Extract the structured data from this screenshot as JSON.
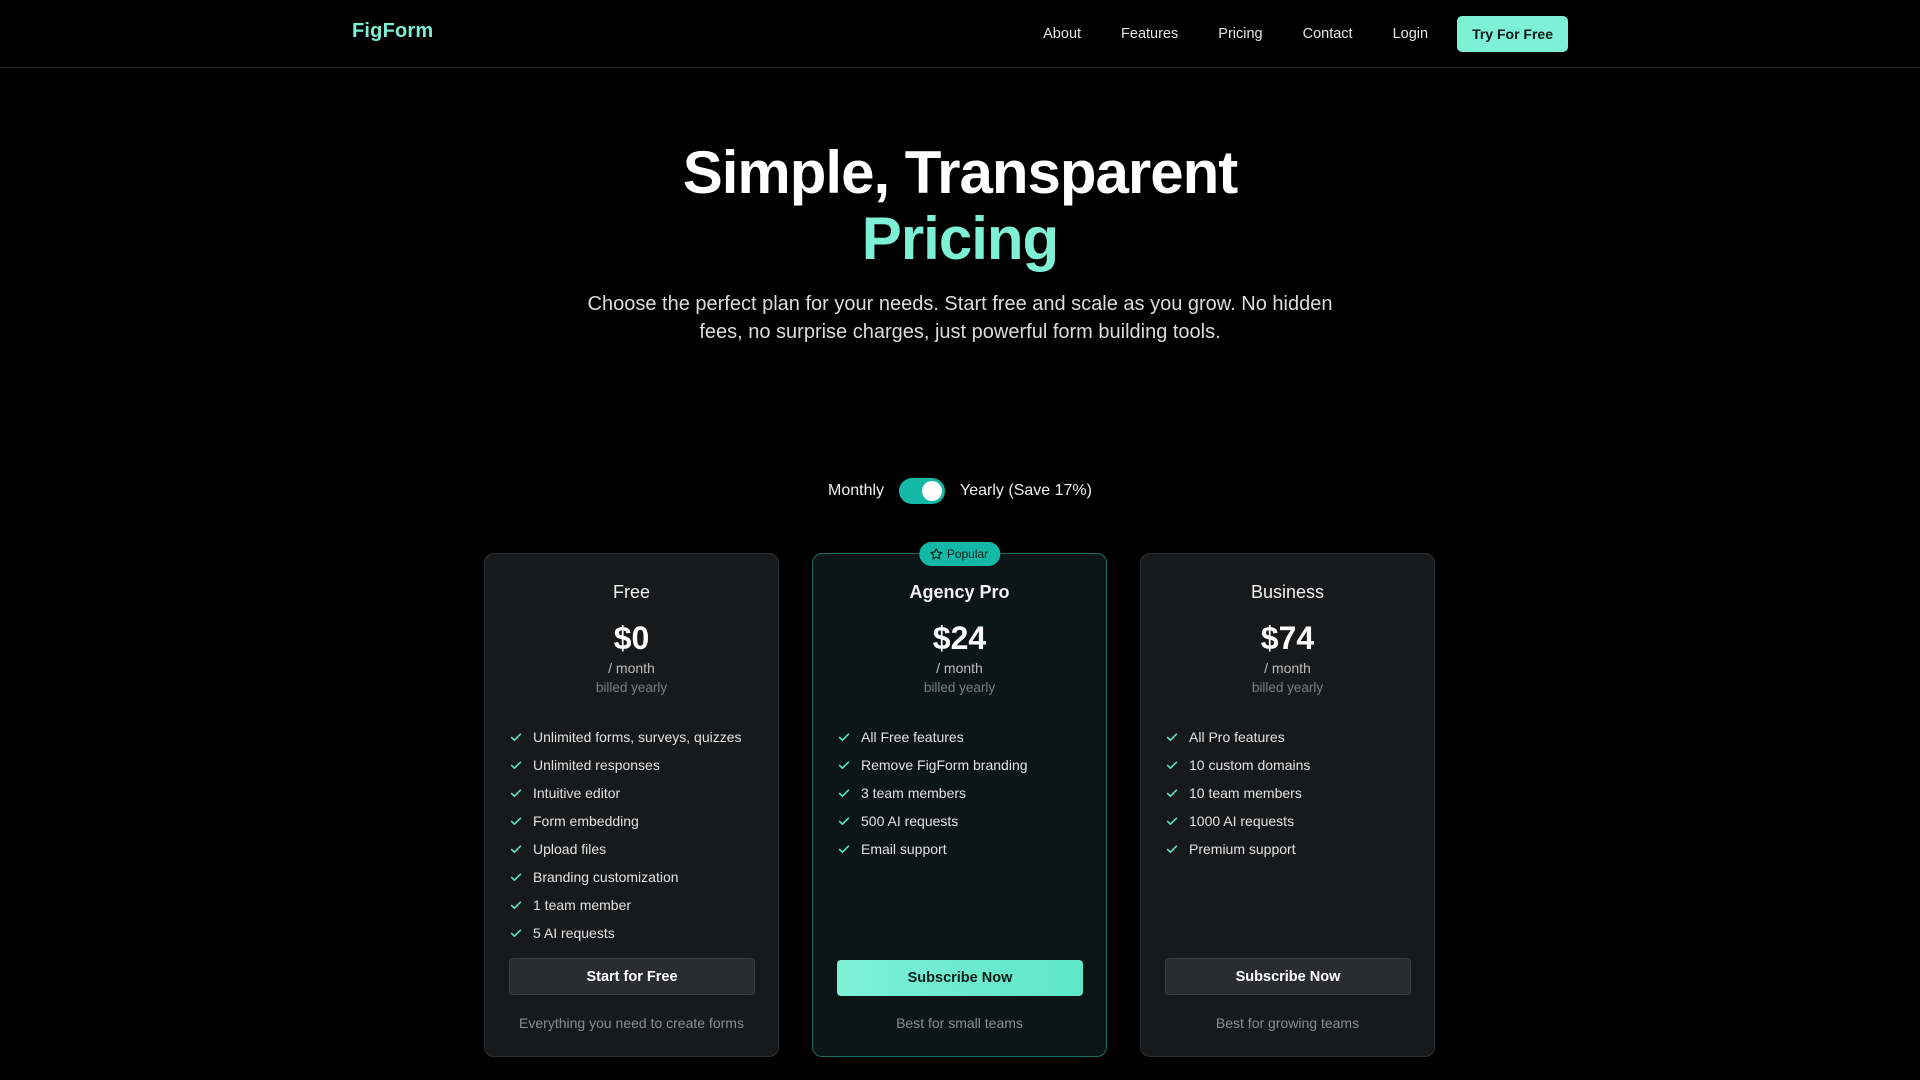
{
  "nav": {
    "logo": "FigForm",
    "links": [
      "About",
      "Features",
      "Pricing",
      "Contact",
      "Login"
    ],
    "cta": "Try For Free"
  },
  "hero": {
    "title_line1": "Simple, Transparent",
    "title_line2": "Pricing",
    "subtitle": "Choose the perfect plan for your needs. Start free and scale as you grow. No hidden fees, no surprise charges, just powerful form building tools."
  },
  "billing": {
    "monthly_label": "Monthly",
    "yearly_label": "Yearly (Save 17%)",
    "yearly_selected": true
  },
  "plans": [
    {
      "name": "Free",
      "price": "$0",
      "period": "/ month",
      "billed": "billed yearly",
      "features": [
        "Unlimited forms, surveys, quizzes",
        "Unlimited responses",
        "Intuitive editor",
        "Form embedding",
        "Upload files",
        "Branding customization",
        "1 team member",
        "5 AI requests"
      ],
      "button": "Start for Free",
      "note": "Everything you need to create forms"
    },
    {
      "name": "Agency Pro",
      "badge": "Popular",
      "price": "$24",
      "period": "/ month",
      "billed": "billed yearly",
      "features": [
        "All Free features",
        "Remove FigForm branding",
        "3 team members",
        "500 AI requests",
        "Email support"
      ],
      "button": "Subscribe Now",
      "note": "Best for small teams"
    },
    {
      "name": "Business",
      "price": "$74",
      "period": "/ month",
      "billed": "billed yearly",
      "features": [
        "All Pro features",
        "10 custom domains",
        "10 team members",
        "1000 AI requests",
        "Premium support"
      ],
      "button": "Subscribe Now",
      "note": "Best for growing teams"
    }
  ],
  "colors": {
    "background": "#000000",
    "accent": "#7ef0d6",
    "toggle": "#14b8a6",
    "card": "#18191b",
    "featured_border": "#1f6b62"
  },
  "icons": {
    "badge": "star-icon",
    "feature": "check-icon"
  }
}
